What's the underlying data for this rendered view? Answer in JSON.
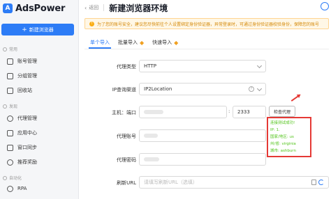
{
  "sidebar": {
    "brand": "AdsPower",
    "new_button": "新建浏览器",
    "sections": [
      {
        "label": "常用"
      },
      {
        "label": "发现"
      },
      {
        "label": "自动化"
      }
    ],
    "items": [
      {
        "label": "账号管理"
      },
      {
        "label": "分组管理"
      },
      {
        "label": "回收站"
      },
      {
        "label": "代理管理"
      },
      {
        "label": "应用中心"
      },
      {
        "label": "窗口同步"
      },
      {
        "label": "推荐奖励"
      },
      {
        "label": "RPA"
      }
    ]
  },
  "header": {
    "back": "返回",
    "title": "新建浏览器环境"
  },
  "notice": "为了您的账号安全，建议您尽快前往个人设置绑定身份验证器，异常登录时，可通过身份验证器校验身份，保障您的账号",
  "tabs": [
    {
      "label": "单个导入"
    },
    {
      "label": "批量导入"
    },
    {
      "label": "快速导入"
    }
  ],
  "form": {
    "proxy_type": {
      "label": "代理类型",
      "value": "HTTP"
    },
    "ip_channel": {
      "label": "IP查询渠道",
      "value": "IP2Location"
    },
    "host_port": {
      "label": "主机：端口",
      "port": "2333"
    },
    "check_button": "检查代理",
    "proxy_account": {
      "label": "代理账号"
    },
    "proxy_password": {
      "label": "代理密码"
    },
    "refresh_url": {
      "label": "刷新URL",
      "placeholder": "请填写刷新URL（选填）"
    }
  },
  "result": {
    "lines": [
      "连接测试成功!",
      "IP: 1.",
      "国家/地区: us",
      "州/省: virginia",
      "城市: ashburn"
    ]
  },
  "colors": {
    "accent": "#2d7cf6",
    "success": "#52c41a",
    "highlight": "#e53935"
  }
}
